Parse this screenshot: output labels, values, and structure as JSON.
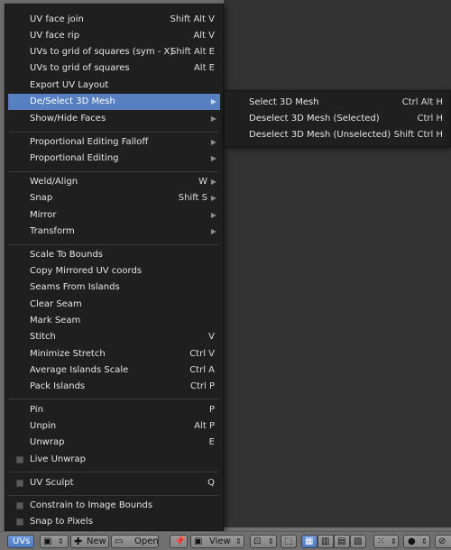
{
  "menu": {
    "items": [
      {
        "label": "UV face join",
        "shortcut": "Shift Alt V"
      },
      {
        "label": "UV face rip",
        "shortcut": "Alt V"
      },
      {
        "label": "UVs to grid of squares (sym - X)",
        "shortcut": "Shift Alt E"
      },
      {
        "label": "UVs to grid of squares",
        "shortcut": "Alt E"
      },
      {
        "label": "Export UV Layout",
        "shortcut": ""
      },
      {
        "label": "De/Select 3D Mesh",
        "shortcut": ""
      },
      {
        "label": "Show/Hide Faces",
        "shortcut": ""
      },
      {
        "label": "Proportional Editing Falloff",
        "shortcut": ""
      },
      {
        "label": "Proportional Editing",
        "shortcut": ""
      },
      {
        "label": "Weld/Align",
        "shortcut": "W"
      },
      {
        "label": "Snap",
        "shortcut": "Shift S"
      },
      {
        "label": "Mirror",
        "shortcut": ""
      },
      {
        "label": "Transform",
        "shortcut": ""
      },
      {
        "label": "Scale To Bounds",
        "shortcut": ""
      },
      {
        "label": "Copy Mirrored UV coords",
        "shortcut": ""
      },
      {
        "label": "Seams From Islands",
        "shortcut": ""
      },
      {
        "label": "Clear Seam",
        "shortcut": ""
      },
      {
        "label": "Mark Seam",
        "shortcut": ""
      },
      {
        "label": "Stitch",
        "shortcut": "V"
      },
      {
        "label": "Minimize Stretch",
        "shortcut": "Ctrl V"
      },
      {
        "label": "Average Islands Scale",
        "shortcut": "Ctrl A"
      },
      {
        "label": "Pack Islands",
        "shortcut": "Ctrl P"
      },
      {
        "label": "Pin",
        "shortcut": "P"
      },
      {
        "label": "Unpin",
        "shortcut": "Alt P"
      },
      {
        "label": "Unwrap",
        "shortcut": "E"
      },
      {
        "label": "Live Unwrap",
        "shortcut": ""
      },
      {
        "label": "UV Sculpt",
        "shortcut": "Q"
      },
      {
        "label": "Constrain to Image Bounds",
        "shortcut": ""
      },
      {
        "label": "Snap to Pixels",
        "shortcut": ""
      }
    ]
  },
  "submenu": {
    "items": [
      {
        "label": "Select 3D Mesh",
        "shortcut": "Ctrl Alt H"
      },
      {
        "label": "Deselect 3D Mesh (Selected)",
        "shortcut": "Ctrl H"
      },
      {
        "label": "Deselect 3D Mesh (Unselected)",
        "shortcut": "Shift Ctrl H"
      }
    ]
  },
  "header": {
    "uvs_label": "UVs",
    "new_label": "New",
    "open_label": "Open",
    "view_label": "View"
  },
  "colors": {
    "highlight": "#5680c2",
    "menu_bg": "#1f1f1f"
  }
}
